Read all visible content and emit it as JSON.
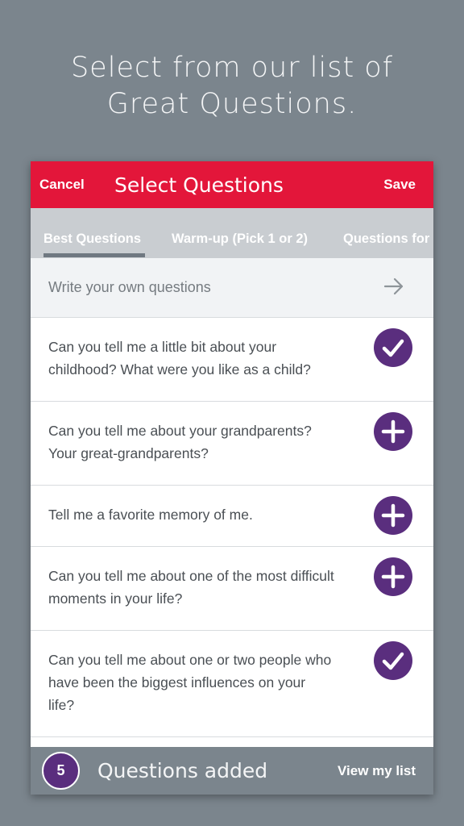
{
  "headline": {
    "line1": "Select from our list of",
    "line2": "Great Questions."
  },
  "topbar": {
    "cancel_label": "Cancel",
    "title": "Select Questions",
    "save_label": "Save"
  },
  "tabs": [
    {
      "label": "Best Questions",
      "active": true
    },
    {
      "label": "Warm-up (Pick 1 or 2)",
      "active": false
    },
    {
      "label": "Questions for",
      "active": false
    }
  ],
  "write_own": {
    "label": "Write your own questions",
    "icon": "arrow-right-icon"
  },
  "questions": [
    {
      "text": "Can you tell me a little bit about your childhood? What were you like as a child?",
      "status": "added",
      "icon": "check-icon"
    },
    {
      "text": "Can you tell me about your grandparents? Your great-grandparents?",
      "status": "not-added",
      "icon": "plus-icon"
    },
    {
      "text": "Tell me a favorite memory of me.",
      "status": "not-added",
      "icon": "plus-icon"
    },
    {
      "text": "Can you tell me about one of the most difficult moments in your life?",
      "status": "not-added",
      "icon": "plus-icon"
    },
    {
      "text": "Can you tell me about one or two people who have been the biggest influences on your life?",
      "status": "added",
      "icon": "check-icon"
    }
  ],
  "bottombar": {
    "count": "5",
    "added_label": "Questions added",
    "view_list_label": "View my list"
  },
  "colors": {
    "background": "#7b858d",
    "accent_red": "#e3163a",
    "purple": "#5a2e7e",
    "tabs_bg": "#c9cdd1"
  }
}
